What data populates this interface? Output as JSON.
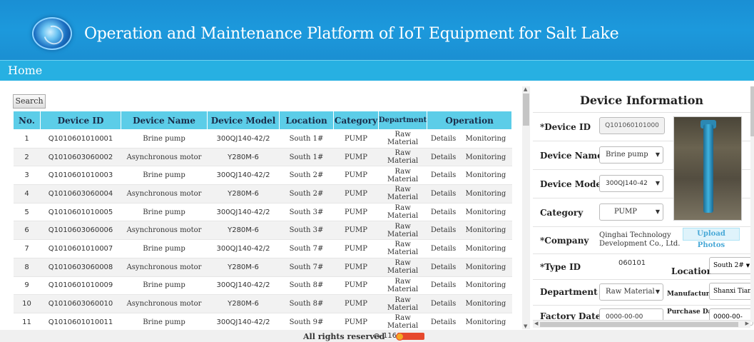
{
  "header": {
    "title": "Operation and Maintenance Platform of IoT Equipment for Salt Lake",
    "logo_icon": "globe-logo-icon"
  },
  "nav": {
    "home": "Home"
  },
  "table": {
    "search_label": "Search",
    "columns": [
      "No.",
      "Device ID",
      "Device Name",
      "Device Model",
      "Location",
      "Category",
      "Department",
      "Operation"
    ],
    "details_label": "Details",
    "monitoring_label": "Monitoring",
    "rows": [
      {
        "no": "1",
        "id": "Q1010601010001",
        "name": "Brine pump",
        "model": "300QJ140-42/2",
        "location": "South 1#",
        "category": "PUMP",
        "dept": "Raw Material"
      },
      {
        "no": "2",
        "id": "Q1010603060002",
        "name": "Asynchronous motor",
        "model": "Y280M-6",
        "location": "South 1#",
        "category": "PUMP",
        "dept": "Raw Material"
      },
      {
        "no": "3",
        "id": "Q1010601010003",
        "name": "Brine pump",
        "model": "300QJ140-42/2",
        "location": "South 2#",
        "category": "PUMP",
        "dept": "Raw Material"
      },
      {
        "no": "4",
        "id": "Q1010603060004",
        "name": "Asynchronous motor",
        "model": "Y280M-6",
        "location": "South 2#",
        "category": "PUMP",
        "dept": "Raw Material"
      },
      {
        "no": "5",
        "id": "Q1010601010005",
        "name": "Brine pump",
        "model": "300QJ140-42/2",
        "location": "South 3#",
        "category": "PUMP",
        "dept": "Raw Material"
      },
      {
        "no": "6",
        "id": "Q1010603060006",
        "name": "Asynchronous motor",
        "model": "Y280M-6",
        "location": "South 3#",
        "category": "PUMP",
        "dept": "Raw Material"
      },
      {
        "no": "7",
        "id": "Q1010601010007",
        "name": "Brine pump",
        "model": "300QJ140-42/2",
        "location": "South 7#",
        "category": "PUMP",
        "dept": "Raw Material"
      },
      {
        "no": "8",
        "id": "Q1010603060008",
        "name": "Asynchronous motor",
        "model": "Y280M-6",
        "location": "South 7#",
        "category": "PUMP",
        "dept": "Raw Material"
      },
      {
        "no": "9",
        "id": "Q1010601010009",
        "name": "Brine pump",
        "model": "300QJ140-42/2",
        "location": "South 8#",
        "category": "PUMP",
        "dept": "Raw Material"
      },
      {
        "no": "10",
        "id": "Q1010603060010",
        "name": "Asynchronous motor",
        "model": "Y280M-6",
        "location": "South 8#",
        "category": "PUMP",
        "dept": "Raw Material"
      },
      {
        "no": "11",
        "id": "Q1010601010011",
        "name": "Brine pump",
        "model": "300QJ140-42/2",
        "location": "South 9#",
        "category": "PUMP",
        "dept": "Raw Material"
      }
    ]
  },
  "device_info": {
    "title": "Device Information",
    "device_id_label": "*Device ID",
    "device_id_value": "Q101060101000",
    "device_name_label": "Device Name",
    "device_name_value": "Brine pump",
    "device_model_label": "Device Model",
    "device_model_value": "300QJ140-42",
    "category_label": "Category",
    "category_value": "PUMP",
    "company_label": "*Company",
    "company_value_line1": "Qinghai Technology",
    "company_value_line2": "Development Co., Ltd.",
    "upload_label": "Upload Photos",
    "type_id_label": "*Type ID",
    "type_id_value": "060101",
    "location_label": "Location",
    "location_value": "South 2#",
    "department_label": "Department",
    "department_value": "Raw Material",
    "manufacturer_label": "Manufacturer",
    "manufacturer_value": "Shanxi Tian",
    "factory_date_label": "Factory Date",
    "factory_date_value": "0000-00-00",
    "purchase_date_label": "Purchase Date",
    "purchase_date_value": "0000-00-"
  },
  "footer": {
    "text": "All rights reserved",
    "count": "116"
  }
}
